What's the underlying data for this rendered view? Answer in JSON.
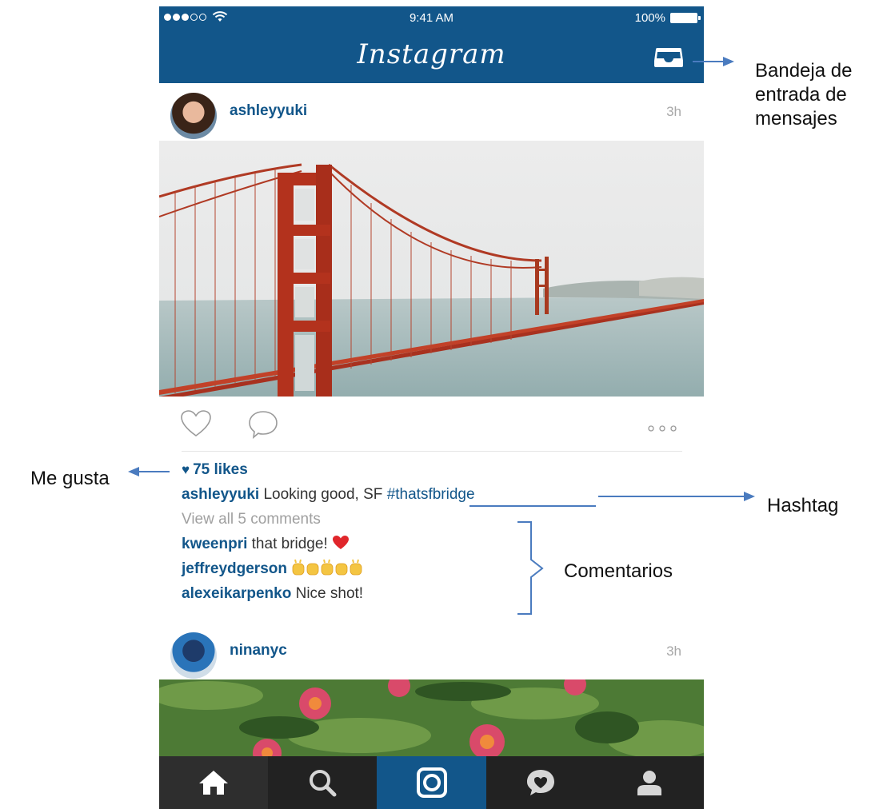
{
  "status_bar": {
    "time": "9:41 AM",
    "battery": "100%"
  },
  "app": {
    "title": "Instagram"
  },
  "post1": {
    "username": "ashleyyuki",
    "age": "3h",
    "likes": "75 likes",
    "caption_user": "ashleyyuki",
    "caption_text": "Looking good, SF",
    "hashtag": "#thatsfbridge",
    "view_comments": "View all 5 comments",
    "comments": [
      {
        "user": "kweenpri",
        "text": "that bridge!"
      },
      {
        "user": "jeffreydgerson",
        "text": ""
      },
      {
        "user": "alexeikarpenko",
        "text": "Nice shot!"
      }
    ]
  },
  "post2": {
    "username": "ninanyc",
    "age": "3h"
  },
  "annotations": {
    "inbox_line1": "Bandeja de",
    "inbox_line2": "entrada de",
    "inbox_line3": "mensajes",
    "likes": "Me gusta",
    "hashtag": "Hashtag",
    "comments": "Comentarios"
  },
  "colors": {
    "brand": "#12568a",
    "tabbar": "#222222",
    "arrow": "#4a7bbf"
  },
  "icons": [
    "inbox-icon",
    "heart-icon",
    "comment-icon",
    "more-icon",
    "home-icon",
    "search-icon",
    "camera-icon",
    "activity-icon",
    "profile-icon"
  ]
}
